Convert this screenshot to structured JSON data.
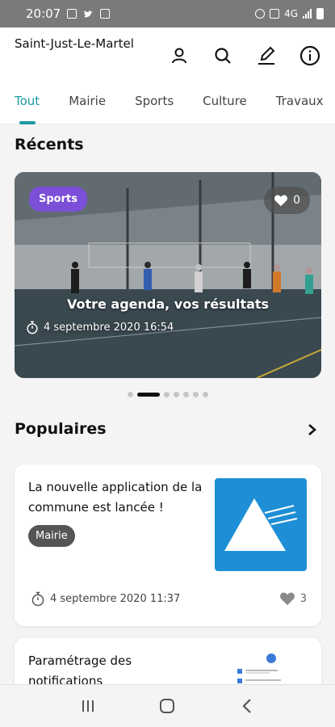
{
  "status_bar": {
    "time": "20:07",
    "icons_left": [
      "image-icon",
      "twitter-icon",
      "check-icon"
    ],
    "icons_right": [
      "alarm-icon",
      "mute-icon",
      "wifi-icon",
      "signal-icon",
      "battery-icon"
    ],
    "network_label": "4G"
  },
  "header": {
    "town": "Saint-Just-Le-Martel",
    "icons": [
      "user-icon",
      "search-icon",
      "edit-icon",
      "info-icon"
    ]
  },
  "tabs": [
    {
      "label": "Tout",
      "active": true
    },
    {
      "label": "Mairie",
      "active": false
    },
    {
      "label": "Sports",
      "active": false
    },
    {
      "label": "Culture",
      "active": false
    },
    {
      "label": "Travaux",
      "active": false
    }
  ],
  "recents": {
    "title": "Récents",
    "featured": {
      "category": "Sports",
      "likes": "0",
      "headline": "Votre agenda, vos résultats",
      "date": "4 septembre 2020 16:54"
    },
    "carousel_count": 7,
    "carousel_active_index": 1
  },
  "populaires": {
    "title": "Populaires",
    "cards": [
      {
        "title": "La nouvelle application de la commune est lancée !",
        "tag": "Mairie",
        "date": "4 septembre 2020 11:37",
        "likes": "3"
      },
      {
        "title": "Paramétrage des notifications"
      }
    ]
  },
  "nav": {
    "buttons": [
      "recent-apps-icon",
      "home-icon",
      "back-icon"
    ]
  },
  "colors": {
    "accent": "#1a9aa3",
    "sports_badge": "#7b4fd8",
    "mairie_tag": "#555555",
    "thumbnail_blue": "#1e8fd6"
  }
}
